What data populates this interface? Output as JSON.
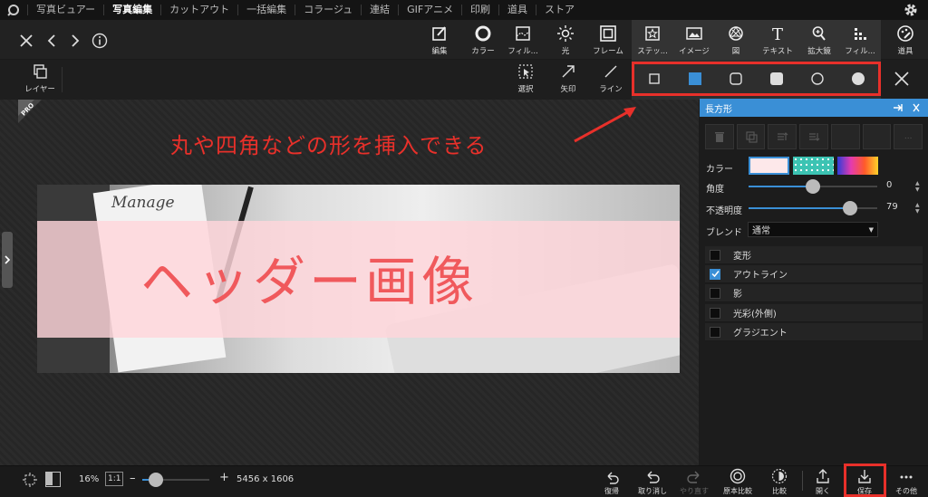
{
  "menu": {
    "items": [
      "写真ビュアー",
      "写真編集",
      "カットアウト",
      "一括編集",
      "コラージュ",
      "連結",
      "GIFアニメ",
      "印刷",
      "道具",
      "ストア"
    ],
    "active": "写真編集"
  },
  "toolbar": {
    "tools": [
      {
        "label": "編集",
        "icon": "edit-icon"
      },
      {
        "label": "カラー",
        "icon": "color-icon"
      },
      {
        "label": "フィル...",
        "icon": "filter-icon"
      },
      {
        "label": "光",
        "icon": "light-icon"
      },
      {
        "label": "フレーム",
        "icon": "frame-icon"
      },
      {
        "label": "ステッ...",
        "icon": "sticker-icon"
      },
      {
        "label": "イメージ",
        "icon": "image-icon"
      },
      {
        "label": "図",
        "icon": "shape-icon"
      },
      {
        "label": "テキスト",
        "icon": "text-icon"
      },
      {
        "label": "拡大鏡",
        "icon": "magnifier-icon"
      },
      {
        "label": "フィル...",
        "icon": "fill-icon"
      },
      {
        "label": "道具",
        "icon": "tools-icon"
      }
    ]
  },
  "subtoolbar": {
    "layer_label": "レイヤー",
    "select_label": "選択",
    "arrow_label": "矢印",
    "line_label": "ライン"
  },
  "shapes": [
    "rect-outline",
    "rect-filled",
    "rounded-rect-outline",
    "rounded-rect-filled",
    "circle-outline",
    "circle-filled"
  ],
  "canvas": {
    "pro_badge": "PRO",
    "annotation": "丸や四角などの形を挿入できる",
    "photo_text": "Manage",
    "headline": "ヘッダー画像"
  },
  "panel": {
    "title": "長方形",
    "color_label": "カラー",
    "angle_label": "角度",
    "angle_value": "0",
    "angle_fraction": 0.5,
    "opacity_label": "不透明度",
    "opacity_value": "79",
    "opacity_fraction": 0.79,
    "blend_label": "ブレンド",
    "blend_value": "通常",
    "options": [
      {
        "label": "変形",
        "checked": false
      },
      {
        "label": "アウトライン",
        "checked": true
      },
      {
        "label": "影",
        "checked": false
      },
      {
        "label": "光彩(外側)",
        "checked": false
      },
      {
        "label": "グラジエント",
        "checked": false
      }
    ]
  },
  "bottom": {
    "zoom": "16%",
    "ratio_label": "1:1",
    "zoom_fraction": 0.2,
    "dimensions": "5456 x 1606",
    "buttons": [
      {
        "label": "復帰",
        "enabled": true
      },
      {
        "label": "取り消し",
        "enabled": true
      },
      {
        "label": "やり直す",
        "enabled": false
      },
      {
        "label": "原本比較",
        "enabled": true
      },
      {
        "label": "比較",
        "enabled": true
      },
      {
        "label": "開く",
        "enabled": true
      },
      {
        "label": "保存",
        "enabled": true
      },
      {
        "label": "その他",
        "enabled": true
      }
    ]
  },
  "colors": {
    "accent": "#3a8fd6",
    "highlight_red": "#e8302a",
    "headline": "#f0595c"
  }
}
